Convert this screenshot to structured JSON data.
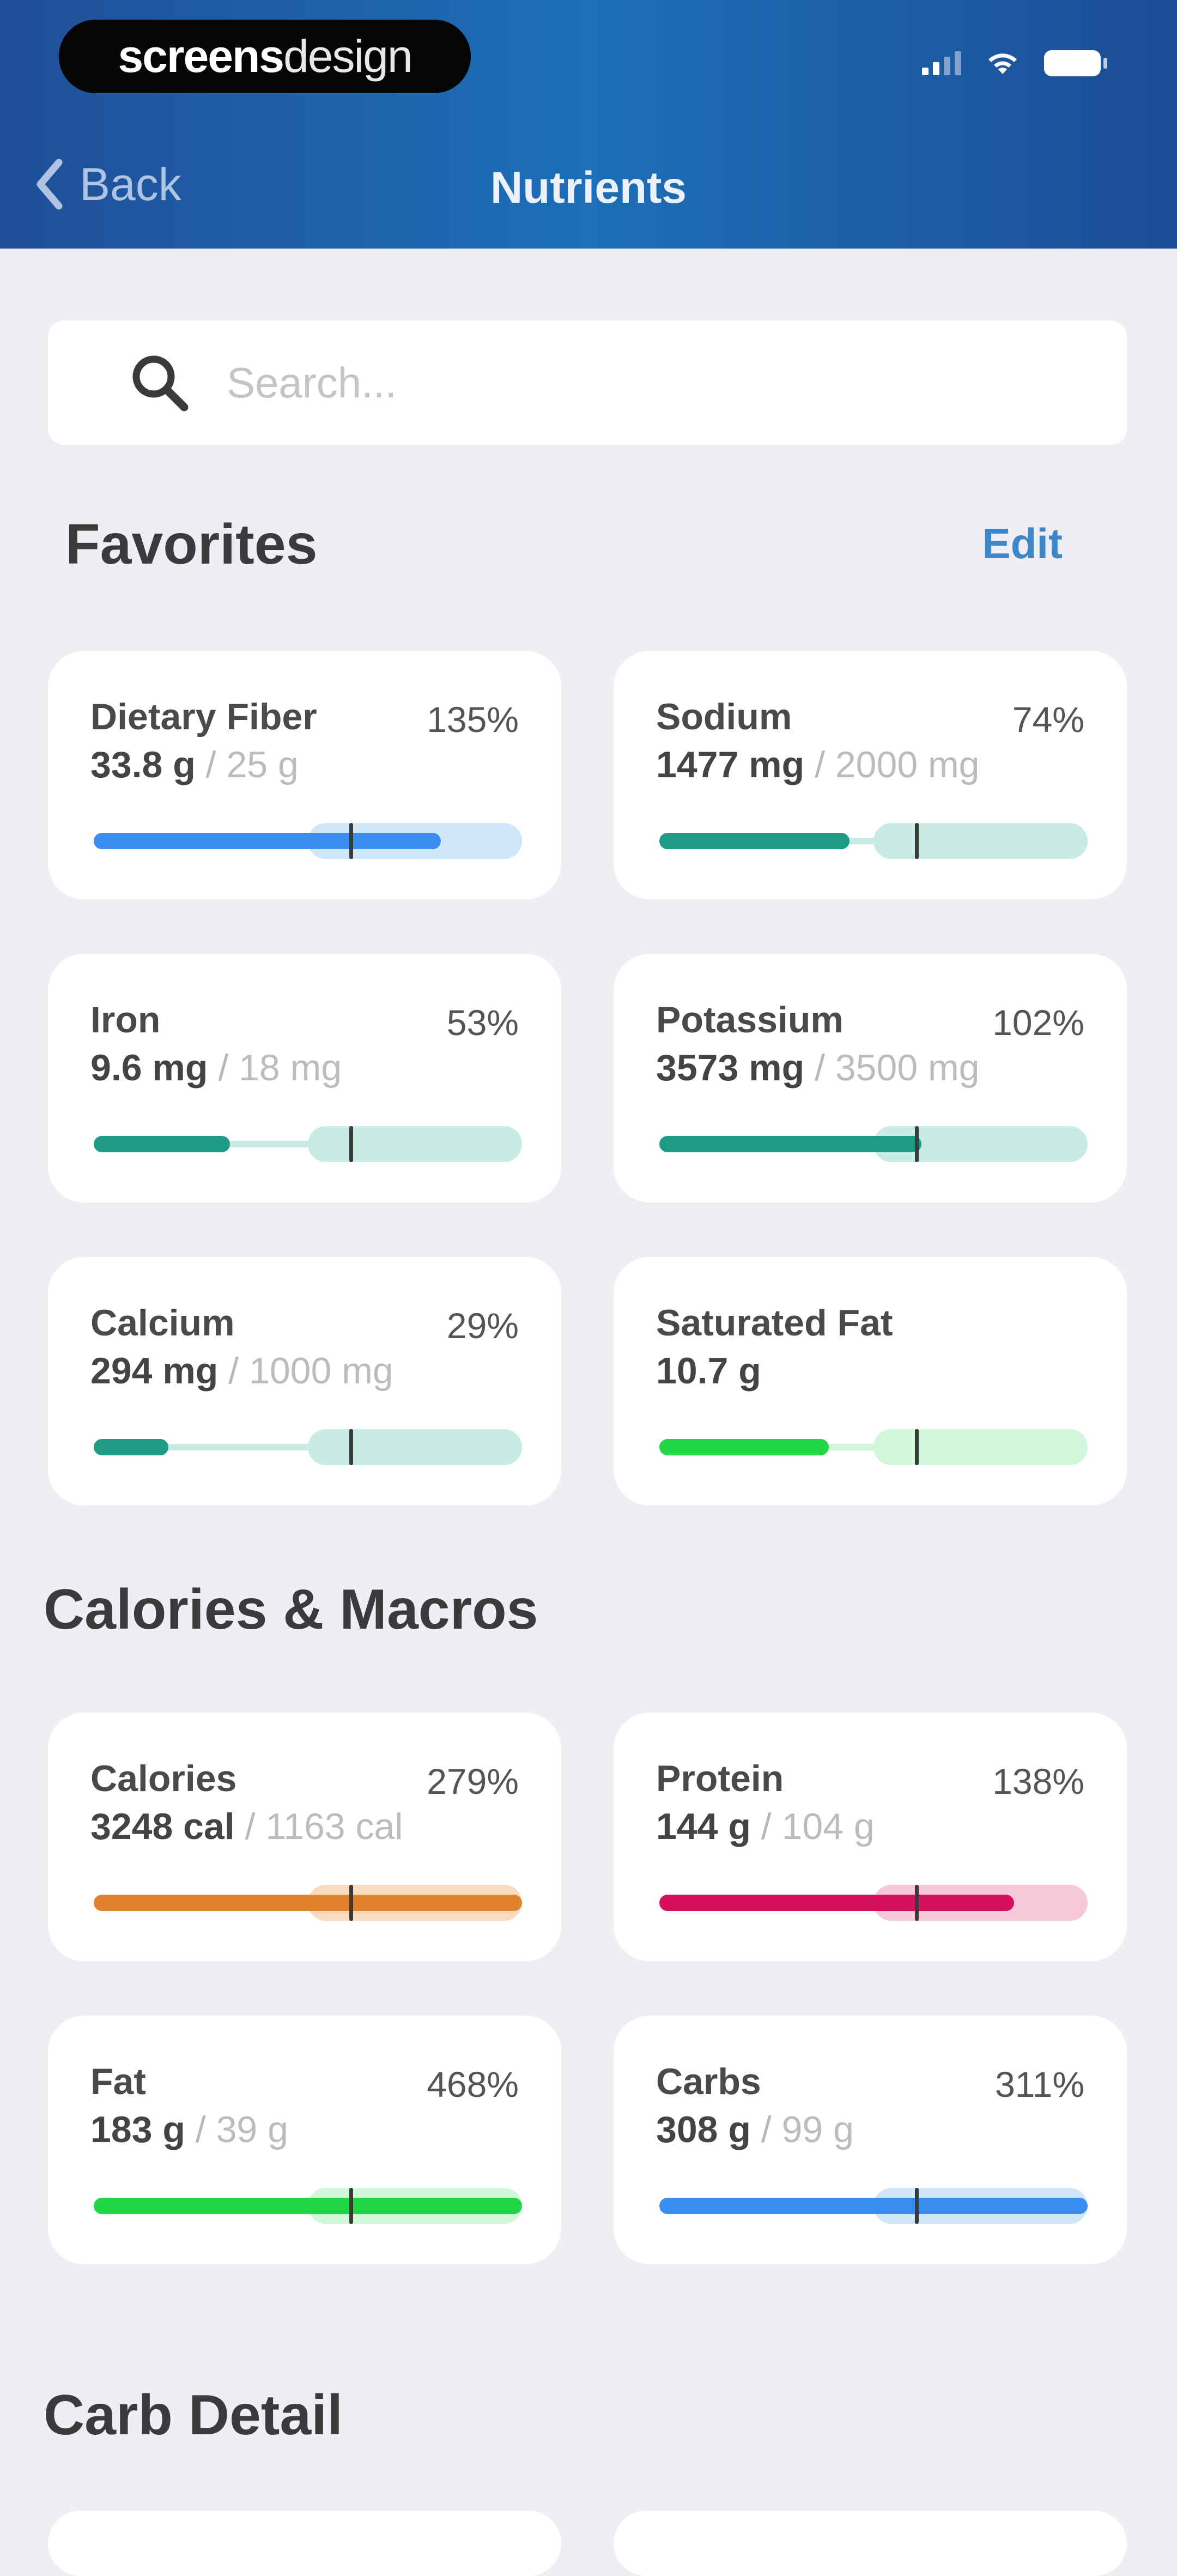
{
  "status_bar": {
    "brand_bold": "screens",
    "brand_light": "design"
  },
  "nav": {
    "back_label": "Back",
    "title": "Nutrients"
  },
  "search": {
    "placeholder": "Search..."
  },
  "favorites": {
    "title": "Favorites",
    "edit_label": "Edit",
    "cards": [
      {
        "name": "Dietary Fiber",
        "amount": "33.8 g",
        "target": "25 g",
        "percent": "135%",
        "fraction": 1.35,
        "color": "#3b8ef0",
        "band": "#cfe6fb"
      },
      {
        "name": "Sodium",
        "amount": "1477 mg",
        "target": "2000 mg",
        "percent": "74%",
        "fraction": 0.74,
        "color": "#1e9b84",
        "band": "#c8ebe3"
      },
      {
        "name": "Iron",
        "amount": "9.6 mg",
        "target": "18 mg",
        "percent": "53%",
        "fraction": 0.53,
        "color": "#1e9b84",
        "band": "#c8ebe3"
      },
      {
        "name": "Potassium",
        "amount": "3573 mg",
        "target": "3500 mg",
        "percent": "102%",
        "fraction": 1.02,
        "color": "#1e9b84",
        "band": "#c8ebe3"
      },
      {
        "name": "Calcium",
        "amount": "294 mg",
        "target": "1000 mg",
        "percent": "29%",
        "fraction": 0.29,
        "color": "#1e9b84",
        "band": "#c8ebe3"
      },
      {
        "name": "Saturated Fat",
        "amount": "10.7 g",
        "target": "",
        "percent": "",
        "fraction": 0.66,
        "color": "#22d645",
        "band": "#d2f6d9"
      }
    ]
  },
  "macros": {
    "title": "Calories & Macros",
    "cards": [
      {
        "name": "Calories",
        "amount": "3248 cal",
        "target": "1163 cal",
        "percent": "279%",
        "fraction": 2.79,
        "color": "#e0812c",
        "band": "#f7dcc2"
      },
      {
        "name": "Protein",
        "amount": "144 g",
        "target": "104 g",
        "percent": "138%",
        "fraction": 1.38,
        "color": "#d6105a",
        "band": "#f7c8d9"
      },
      {
        "name": "Fat",
        "amount": "183 g",
        "target": "39 g",
        "percent": "468%",
        "fraction": 4.68,
        "color": "#22d645",
        "band": "#d2f6d9"
      },
      {
        "name": "Carbs",
        "amount": "308 g",
        "target": "99 g",
        "percent": "311%",
        "fraction": 3.11,
        "color": "#3b8ef0",
        "band": "#cfe6fb"
      }
    ]
  },
  "carb_detail": {
    "title": "Carb Detail"
  },
  "colors": {
    "header_start": "#1f4f98",
    "header_mid": "#1d6fb8",
    "accent_link": "#3e86ca",
    "background": "#eeeef3"
  }
}
